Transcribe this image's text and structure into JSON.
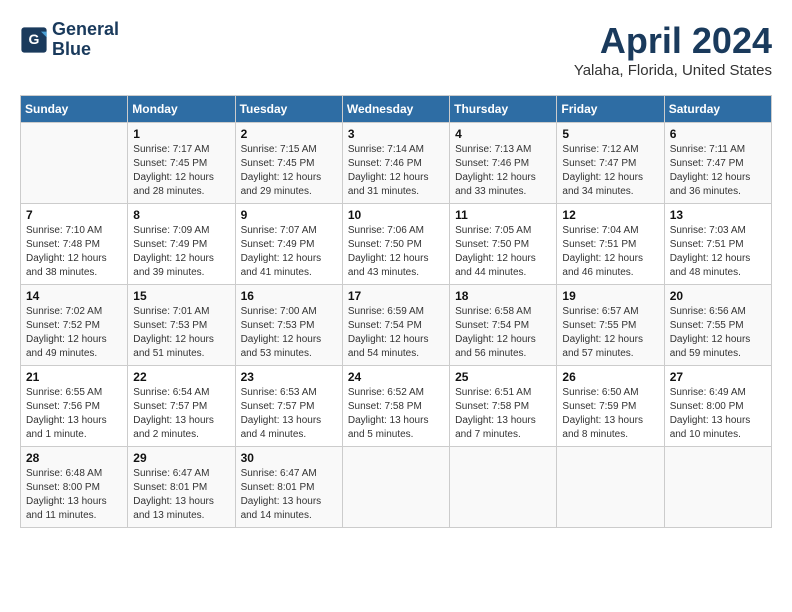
{
  "header": {
    "logo_line1": "General",
    "logo_line2": "Blue",
    "month": "April 2024",
    "location": "Yalaha, Florida, United States"
  },
  "weekdays": [
    "Sunday",
    "Monday",
    "Tuesday",
    "Wednesday",
    "Thursday",
    "Friday",
    "Saturday"
  ],
  "weeks": [
    [
      {
        "day": "",
        "info": ""
      },
      {
        "day": "1",
        "info": "Sunrise: 7:17 AM\nSunset: 7:45 PM\nDaylight: 12 hours\nand 28 minutes."
      },
      {
        "day": "2",
        "info": "Sunrise: 7:15 AM\nSunset: 7:45 PM\nDaylight: 12 hours\nand 29 minutes."
      },
      {
        "day": "3",
        "info": "Sunrise: 7:14 AM\nSunset: 7:46 PM\nDaylight: 12 hours\nand 31 minutes."
      },
      {
        "day": "4",
        "info": "Sunrise: 7:13 AM\nSunset: 7:46 PM\nDaylight: 12 hours\nand 33 minutes."
      },
      {
        "day": "5",
        "info": "Sunrise: 7:12 AM\nSunset: 7:47 PM\nDaylight: 12 hours\nand 34 minutes."
      },
      {
        "day": "6",
        "info": "Sunrise: 7:11 AM\nSunset: 7:47 PM\nDaylight: 12 hours\nand 36 minutes."
      }
    ],
    [
      {
        "day": "7",
        "info": "Sunrise: 7:10 AM\nSunset: 7:48 PM\nDaylight: 12 hours\nand 38 minutes."
      },
      {
        "day": "8",
        "info": "Sunrise: 7:09 AM\nSunset: 7:49 PM\nDaylight: 12 hours\nand 39 minutes."
      },
      {
        "day": "9",
        "info": "Sunrise: 7:07 AM\nSunset: 7:49 PM\nDaylight: 12 hours\nand 41 minutes."
      },
      {
        "day": "10",
        "info": "Sunrise: 7:06 AM\nSunset: 7:50 PM\nDaylight: 12 hours\nand 43 minutes."
      },
      {
        "day": "11",
        "info": "Sunrise: 7:05 AM\nSunset: 7:50 PM\nDaylight: 12 hours\nand 44 minutes."
      },
      {
        "day": "12",
        "info": "Sunrise: 7:04 AM\nSunset: 7:51 PM\nDaylight: 12 hours\nand 46 minutes."
      },
      {
        "day": "13",
        "info": "Sunrise: 7:03 AM\nSunset: 7:51 PM\nDaylight: 12 hours\nand 48 minutes."
      }
    ],
    [
      {
        "day": "14",
        "info": "Sunrise: 7:02 AM\nSunset: 7:52 PM\nDaylight: 12 hours\nand 49 minutes."
      },
      {
        "day": "15",
        "info": "Sunrise: 7:01 AM\nSunset: 7:53 PM\nDaylight: 12 hours\nand 51 minutes."
      },
      {
        "day": "16",
        "info": "Sunrise: 7:00 AM\nSunset: 7:53 PM\nDaylight: 12 hours\nand 53 minutes."
      },
      {
        "day": "17",
        "info": "Sunrise: 6:59 AM\nSunset: 7:54 PM\nDaylight: 12 hours\nand 54 minutes."
      },
      {
        "day": "18",
        "info": "Sunrise: 6:58 AM\nSunset: 7:54 PM\nDaylight: 12 hours\nand 56 minutes."
      },
      {
        "day": "19",
        "info": "Sunrise: 6:57 AM\nSunset: 7:55 PM\nDaylight: 12 hours\nand 57 minutes."
      },
      {
        "day": "20",
        "info": "Sunrise: 6:56 AM\nSunset: 7:55 PM\nDaylight: 12 hours\nand 59 minutes."
      }
    ],
    [
      {
        "day": "21",
        "info": "Sunrise: 6:55 AM\nSunset: 7:56 PM\nDaylight: 13 hours\nand 1 minute."
      },
      {
        "day": "22",
        "info": "Sunrise: 6:54 AM\nSunset: 7:57 PM\nDaylight: 13 hours\nand 2 minutes."
      },
      {
        "day": "23",
        "info": "Sunrise: 6:53 AM\nSunset: 7:57 PM\nDaylight: 13 hours\nand 4 minutes."
      },
      {
        "day": "24",
        "info": "Sunrise: 6:52 AM\nSunset: 7:58 PM\nDaylight: 13 hours\nand 5 minutes."
      },
      {
        "day": "25",
        "info": "Sunrise: 6:51 AM\nSunset: 7:58 PM\nDaylight: 13 hours\nand 7 minutes."
      },
      {
        "day": "26",
        "info": "Sunrise: 6:50 AM\nSunset: 7:59 PM\nDaylight: 13 hours\nand 8 minutes."
      },
      {
        "day": "27",
        "info": "Sunrise: 6:49 AM\nSunset: 8:00 PM\nDaylight: 13 hours\nand 10 minutes."
      }
    ],
    [
      {
        "day": "28",
        "info": "Sunrise: 6:48 AM\nSunset: 8:00 PM\nDaylight: 13 hours\nand 11 minutes."
      },
      {
        "day": "29",
        "info": "Sunrise: 6:47 AM\nSunset: 8:01 PM\nDaylight: 13 hours\nand 13 minutes."
      },
      {
        "day": "30",
        "info": "Sunrise: 6:47 AM\nSunset: 8:01 PM\nDaylight: 13 hours\nand 14 minutes."
      },
      {
        "day": "",
        "info": ""
      },
      {
        "day": "",
        "info": ""
      },
      {
        "day": "",
        "info": ""
      },
      {
        "day": "",
        "info": ""
      }
    ]
  ]
}
